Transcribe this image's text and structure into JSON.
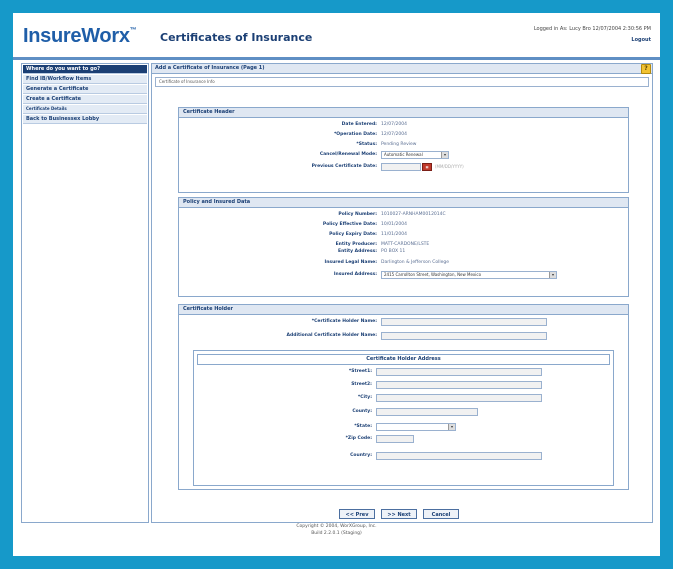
{
  "header": {
    "logo_main": "InsureWor",
    "logo_x": "x",
    "logo_tm": "™",
    "title": "Certificates of Insurance",
    "user_line": "Logged in As: Lucy Bro  12/07/2004  2:30:56 PM",
    "logout": "Logout"
  },
  "sidebar": {
    "items": [
      {
        "label": "Where do you want to go?"
      },
      {
        "label": "Find IB/Workflow Items"
      },
      {
        "label": "Generate a Certificate"
      },
      {
        "label": "Create a Certificate"
      },
      {
        "label": "Certificate Details"
      },
      {
        "label": "Back to Businessex Lobby"
      }
    ]
  },
  "main": {
    "heading": "Add a Certificate of Insurance (Page 1)",
    "help": "?",
    "breadcrumb": "Certificate of Insurance Info",
    "certificate_header": {
      "title": "Certificate Header",
      "rows": [
        {
          "label": "Date Entered:",
          "value": "12/07/2004"
        },
        {
          "label": "*Operation Date:",
          "value": "12/07/2004"
        },
        {
          "label": "*Status:",
          "value": "Pending Review"
        },
        {
          "label": "Cancel/Renewal Mode:",
          "select": "Automatic Renewal"
        },
        {
          "label": "Previous Certificate Date:",
          "hint": "(MM/DD/YYYY)"
        }
      ]
    },
    "policy": {
      "title": "Policy and Insured Data",
      "rows": [
        {
          "label": "Policy Number:",
          "value": "1010027-ARNHAM0012014C"
        },
        {
          "label": "Policy Effective Date:",
          "value": "10/01/2004"
        },
        {
          "label": "Policy Expiry Date:",
          "value": "11/01/2004"
        },
        {
          "label": "Entity Producer:",
          "value": "MATT-CARDONE/LSTE"
        },
        {
          "label": "Entity Address:",
          "value": "PO BOX 11"
        },
        {
          "label": "Insured Legal Name:",
          "value": "Darlington & Jefferson College"
        },
        {
          "label": "Insured Address:",
          "select": "2415 Carrollton Street, Washington, New Mexico"
        }
      ]
    },
    "holder": {
      "title": "Certificate Holder",
      "rows": [
        {
          "label": "*Certificate Holder Name:"
        },
        {
          "label": "Additional Certificate Holder Name:"
        }
      ],
      "address": {
        "title": "Certificate Holder Address",
        "rows": [
          {
            "label": "*Street1:"
          },
          {
            "label": "Street2:"
          },
          {
            "label": "*City:"
          },
          {
            "label": "County:"
          },
          {
            "label": "*State:"
          },
          {
            "label": "*Zip Code:"
          },
          {
            "label": "Country:"
          }
        ]
      }
    },
    "buttons": {
      "prev": "<< Prev",
      "next": ">> Next",
      "cancel": "Cancel"
    }
  },
  "footer": {
    "copyright": "Copyright © 2004, WorXGroup, Inc.",
    "version": "Build 2.2.0.1 (Staging)"
  }
}
